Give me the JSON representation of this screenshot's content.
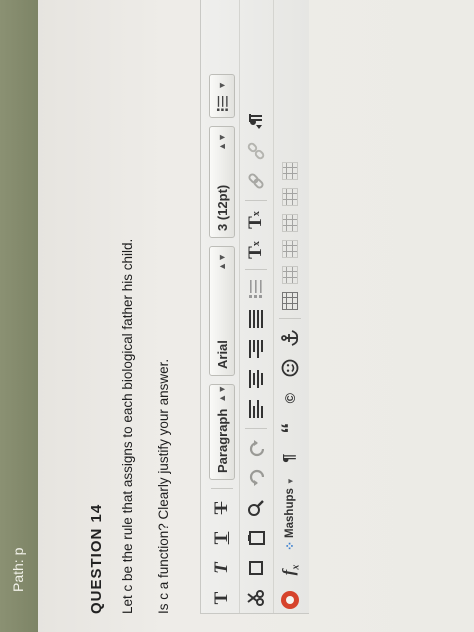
{
  "path_bar": {
    "label": "Path: p"
  },
  "question": {
    "title": "QUESTION 14",
    "line1": "Let c be the rule that assigns to each biological father his child.",
    "line2": "Is c a function?  Clearly justify your answer."
  },
  "toolbar": {
    "row1": {
      "bold": "T",
      "italic": "T",
      "underline": "T",
      "strikethrough": "T",
      "paragraph": "Paragraph",
      "font": "Arial",
      "size": "3 (12pt)"
    },
    "row2": {
      "superscript": "T",
      "subscript": "T"
    },
    "row3": {
      "mashups": "Mashups",
      "pilcrow": "¶",
      "quote": "“"
    }
  },
  "colors": {
    "path_bar": "#858b6d",
    "accent_red": "#d6432b",
    "mashups_dots": "#3a7fd0"
  },
  "icons": [
    "cut-icon",
    "copy-icon",
    "paste-icon",
    "find-icon",
    "undo-icon",
    "redo-icon",
    "align-left-icon",
    "align-center-icon",
    "align-right-icon",
    "align-justify-icon",
    "link-icon",
    "unlink-icon",
    "function-icon",
    "copyright-icon",
    "smiley-icon",
    "anchor-icon",
    "table-icon",
    "pilcrow-icon",
    "quote-icon"
  ]
}
